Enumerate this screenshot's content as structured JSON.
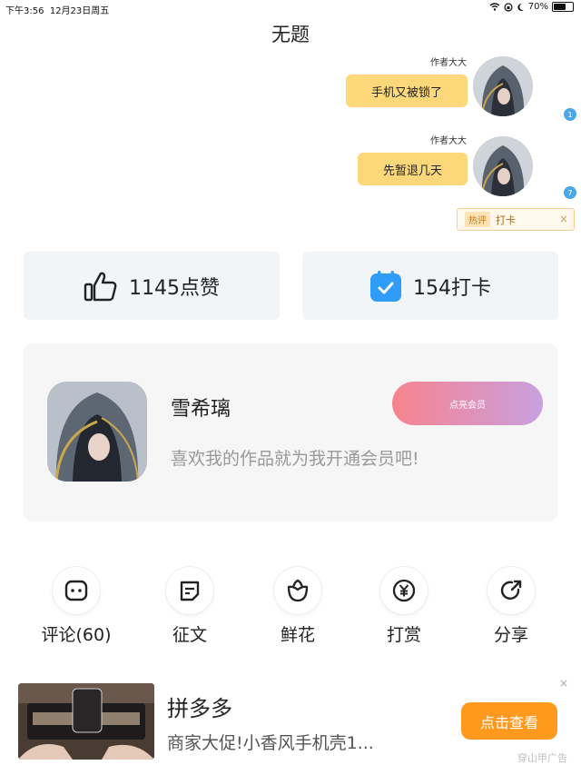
{
  "status_bar": {
    "time": "下午3:56",
    "date": "12月23日周五",
    "battery_text": "70%",
    "battery_level": 0.7
  },
  "page": {
    "title": "无题"
  },
  "chat": {
    "messages": [
      {
        "author": "作者大大",
        "text": "手机又被锁了",
        "badge": "1"
      },
      {
        "author": "作者大大",
        "text": "先暂退几天",
        "badge": "7"
      }
    ],
    "hot_comment": {
      "tag": "热评",
      "text": "打卡",
      "close": "×"
    }
  },
  "stats": {
    "likes": "1145点赞",
    "checkins": "154打卡"
  },
  "member_card": {
    "name": "雪希璃",
    "description": "喜欢我的作品就为我开通会员吧!",
    "button": "点亮会员"
  },
  "actions": [
    {
      "label": "评论(60)",
      "icon": "comment-icon"
    },
    {
      "label": "征文",
      "icon": "essay-icon"
    },
    {
      "label": "鲜花",
      "icon": "flower-icon"
    },
    {
      "label": "打赏",
      "icon": "yuan-icon"
    },
    {
      "label": "分享",
      "icon": "share-icon"
    }
  ],
  "ad": {
    "title": "拼多多",
    "description": "商家大促!小香风手机壳1...",
    "button": "点击查看",
    "close": "×",
    "source": "穿山甲广告"
  },
  "colors": {
    "bubble": "#fcd87a",
    "badge": "#4aa8e8",
    "ad_button": "#ff9a1f",
    "vip_start": "#f7838e",
    "vip_end": "#c9a0e0",
    "checkin_icon": "#2f9df7"
  }
}
